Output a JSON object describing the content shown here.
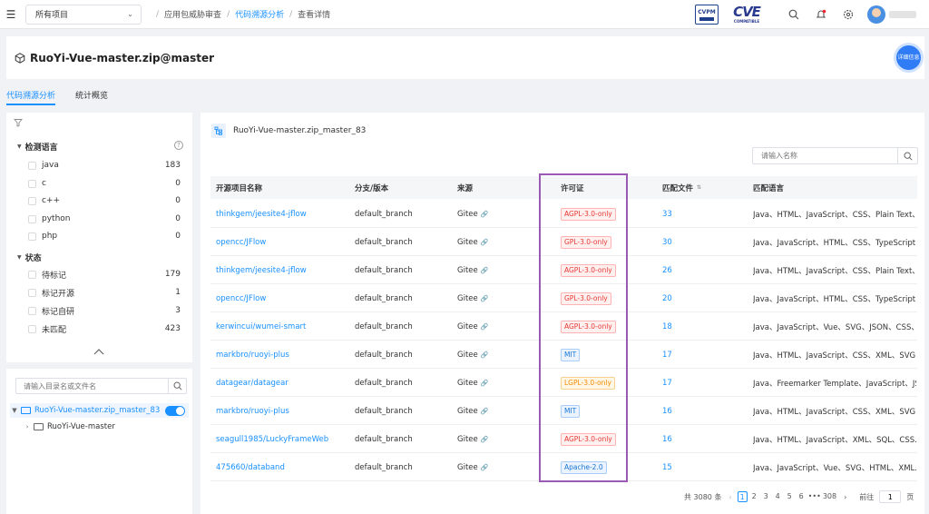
{
  "topbar": {
    "project_select": "所有项目",
    "breadcrumbs": [
      "应用包威胁审查",
      "代码溯源分析",
      "查看详情"
    ],
    "logo1_text": "CVPM",
    "logo2_text": "CVE",
    "logo2_sub": "COMPATIBLE"
  },
  "header": {
    "title": "RuoYi-Vue-master.zip@master",
    "detail_btn": "详细信息"
  },
  "tabs": [
    "代码溯源分析",
    "统计概览"
  ],
  "filters": {
    "lang_title": "检测语言",
    "langs": [
      {
        "label": "java",
        "count": "183"
      },
      {
        "label": "c",
        "count": "0"
      },
      {
        "label": "c++",
        "count": "0"
      },
      {
        "label": "python",
        "count": "0"
      },
      {
        "label": "php",
        "count": "0"
      }
    ],
    "status_title": "状态",
    "statuses": [
      {
        "label": "待标记",
        "count": "179"
      },
      {
        "label": "标记开源",
        "count": "1"
      },
      {
        "label": "标记自研",
        "count": "3"
      },
      {
        "label": "未匹配",
        "count": "423"
      }
    ]
  },
  "tree": {
    "search_placeholder": "请输入目录名或文件名",
    "root": "RuoYi-Vue-master.zip_master_83",
    "child": "RuoYi-Vue-master"
  },
  "main": {
    "title": "RuoYi-Vue-master.zip_master_83",
    "search_placeholder": "请输入名称",
    "columns": [
      "开源项目名称",
      "分支/版本",
      "来源",
      "许可证",
      "匹配文件",
      "匹配语言"
    ],
    "rows": [
      {
        "name": "thinkgem/jeesite4-jflow",
        "branch": "default_branch",
        "source": "Gitee",
        "license": "AGPL-3.0-only",
        "license_color": "red",
        "files": "33",
        "langs": "Java、HTML、JavaScript、CSS、Plain Text、..."
      },
      {
        "name": "opencc/JFlow",
        "branch": "default_branch",
        "source": "Gitee",
        "license": "GPL-3.0-only",
        "license_color": "red",
        "files": "30",
        "langs": "Java、JavaScript、HTML、CSS、TypeScript ..."
      },
      {
        "name": "thinkgem/jeesite4-jflow",
        "branch": "default_branch",
        "source": "Gitee",
        "license": "AGPL-3.0-only",
        "license_color": "red",
        "files": "26",
        "langs": "Java、HTML、JavaScript、CSS、Plain Text、..."
      },
      {
        "name": "opencc/JFlow",
        "branch": "default_branch",
        "source": "Gitee",
        "license": "GPL-3.0-only",
        "license_color": "red",
        "files": "20",
        "langs": "Java、JavaScript、HTML、CSS、TypeScript ..."
      },
      {
        "name": "kerwincui/wumei-smart",
        "branch": "default_branch",
        "source": "Gitee",
        "license": "AGPL-3.0-only",
        "license_color": "red",
        "files": "18",
        "langs": "Java、JavaScript、Vue、SVG、JSON、CSS、..."
      },
      {
        "name": "markbro/ruoyi-plus",
        "branch": "default_branch",
        "source": "Gitee",
        "license": "MIT",
        "license_color": "blue",
        "files": "17",
        "langs": "Java、HTML、JavaScript、CSS、XML、SVG..."
      },
      {
        "name": "datagear/datagear",
        "branch": "default_branch",
        "source": "Gitee",
        "license": "LGPL-3.0-only",
        "license_color": "orange",
        "files": "17",
        "langs": "Java、Freemarker Template、JavaScript、JS..."
      },
      {
        "name": "markbro/ruoyi-plus",
        "branch": "default_branch",
        "source": "Gitee",
        "license": "MIT",
        "license_color": "blue",
        "files": "16",
        "langs": "Java、HTML、JavaScript、CSS、XML、SVG..."
      },
      {
        "name": "seagull1985/LuckyFrameWeb",
        "branch": "default_branch",
        "source": "Gitee",
        "license": "AGPL-3.0-only",
        "license_color": "red",
        "files": "16",
        "langs": "Java、HTML、JavaScript、XML、SQL、CSS..."
      },
      {
        "name": "475660/databand",
        "branch": "default_branch",
        "source": "Gitee",
        "license": "Apache-2.0",
        "license_color": "blue",
        "files": "15",
        "langs": "Java、JavaScript、Vue、SVG、HTML、XML..."
      }
    ]
  },
  "pager": {
    "total": "共 3080 条",
    "pages": [
      "1",
      "2",
      "3",
      "4",
      "5",
      "6",
      "•••",
      "308"
    ],
    "current": "1",
    "goto_label": "前往",
    "goto_value": "1"
  }
}
